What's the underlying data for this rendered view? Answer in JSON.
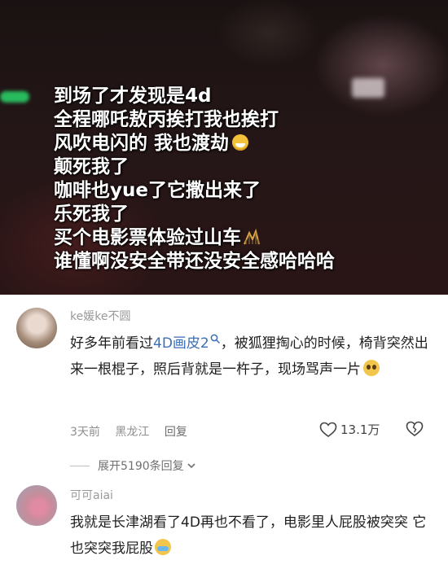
{
  "video": {
    "caption_lines": [
      "到场了才发现是4d",
      "全程哪吒敖丙挨打我也挨打",
      "风吹电闪的 我也渡劫",
      "颠死我了",
      "咖啡也yue了它撒出来了",
      "乐死我了",
      "买个电影票体验过山车",
      "谁懂啊没安全带还没安全感哈哈哈"
    ]
  },
  "comments": [
    {
      "username": "ke媛ke不圆",
      "text_before": "好多年前看过",
      "text_link": "4D画皮2",
      "text_after": "，被狐狸掏心的时候，椅背突然出来一根棍子，照后背就是一杵子，现场骂声一片",
      "time": "3天前",
      "location": "黑龙江",
      "reply_label": "回复",
      "likes": "13.1万",
      "expand_label": "展开5190条回复"
    },
    {
      "username": "可可aiai",
      "text": "我就是长津湖看了4D再也不看了，电影里人屁股被突突 它也突突我屁股"
    }
  ],
  "icons": {
    "emoji_grin": "grinning-face",
    "coaster": "roller-coaster",
    "search": "search-icon",
    "emoji_pleading": "pleading-face",
    "emoji_cry": "crying-face",
    "heart": "heart-outline",
    "dislike": "broken-heart-outline",
    "chevron": "chevron-down"
  }
}
